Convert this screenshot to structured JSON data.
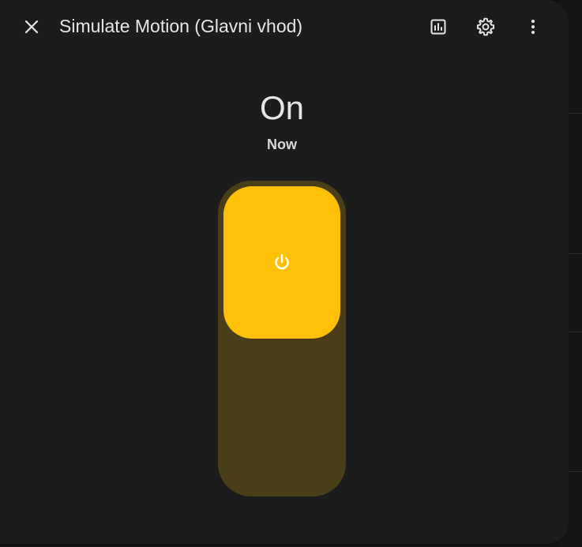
{
  "dialog": {
    "title": "Simulate Motion (Glavni vhod)"
  },
  "header_icons": {
    "close": "close-icon",
    "history": "chart-icon",
    "settings": "gear-icon",
    "more": "dots-vertical-icon"
  },
  "entity": {
    "state": "On",
    "last_changed": "Now",
    "toggle": {
      "is_on": true,
      "icon": "power-icon"
    }
  },
  "colors": {
    "accent": "#ffc107",
    "track": "#4a3e19",
    "surface": "#1c1c1c"
  }
}
